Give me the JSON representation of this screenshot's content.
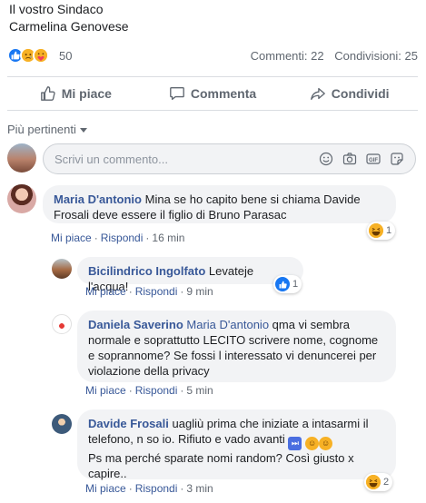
{
  "post": {
    "signature_line1": "Il vostro Sindaco",
    "signature_line2": "Carmelina Genovese"
  },
  "stats": {
    "reactions_count": "50",
    "comments": "Commenti: 22",
    "shares": "Condivisioni: 25",
    "reaction_icons": [
      "like-icon",
      "sad-icon",
      "care-icon"
    ]
  },
  "actions": {
    "like": "Mi piace",
    "comment": "Commenta",
    "share": "Condividi"
  },
  "sort": {
    "label": "Più pertinenti"
  },
  "composer": {
    "placeholder": "Scrivi un commento..."
  },
  "comments": [
    {
      "author": "Maria D'antonio",
      "text": "Mina se ho capito bene si chiama Davide Frosali deve essere il figlio di Bruno Parasac",
      "like": "Mi piace",
      "reply": "Rispondi",
      "time": "16 min",
      "reaction_count": "1",
      "reaction_icon": "laugh-icon"
    },
    {
      "author": "Bicilindrico Ingolfato",
      "text": "Levateje l'acqua!",
      "like": "Mi piace",
      "reply": "Rispondi",
      "time": "9 min",
      "reaction_count": "1",
      "reaction_icon": "like-icon"
    },
    {
      "author": "Daniela Saverino",
      "mention": "Maria D'antonio",
      "text": "qma vi sembra normale e soprattutto LECITO scrivere nome, cognome e soprannome? Se fossi l interessato vi denuncerei per violazione della privacy",
      "like": "Mi piace",
      "reply": "Rispondi",
      "time": "5 min"
    },
    {
      "author": "Davide Frosali",
      "text_part1": "uagliù prima che iniziate a intasarmi il telefono, n so io. Rifiuto e vado avanti",
      "text_part2": "Ps ma perché sparate nomi random? Così giusto x capire..",
      "like": "Mi piace",
      "reply": "Rispondi",
      "time": "3 min",
      "reaction_count": "2",
      "reaction_icon": "laugh-icon"
    }
  ],
  "colors": {
    "link": "#385898",
    "bubble": "#f2f3f5",
    "meta": "#606770",
    "like_blue": "#1877f2",
    "emoji_yellow": "#f7b125"
  }
}
